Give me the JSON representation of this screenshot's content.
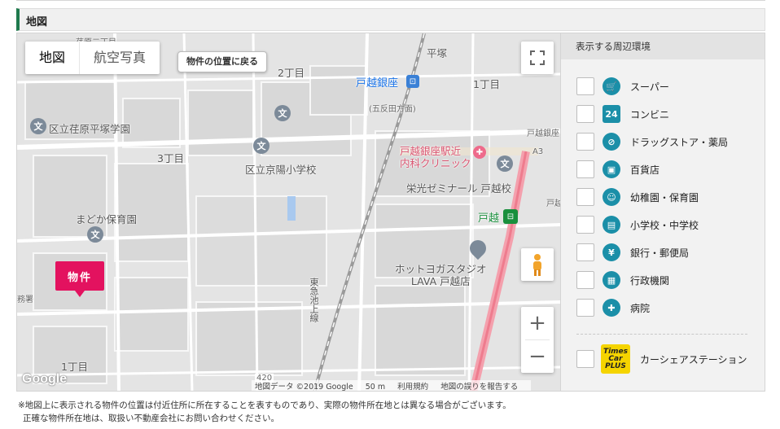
{
  "section": {
    "title": "地図"
  },
  "map": {
    "type_controls": {
      "map": "地図",
      "satellite": "航空写真"
    },
    "return_button": "物件の位置に戻る",
    "property_pin": "物件",
    "labels": {
      "town_name": "荏原二丁目",
      "hiratsuka": "平塚",
      "chome2": "2丁目",
      "chome1_top": "1丁目",
      "chome3": "3丁目",
      "chome1_bottom": "1丁目",
      "station": "戸越銀座",
      "gotanda_dir": "(五反田方面)",
      "station_small": "戸越銀座",
      "school1": "区立荏原平塚学園",
      "school2": "区立京陽小学校",
      "nursery": "まどか保育園",
      "clinic": "戸越銀座駅近\n内科クリニック",
      "seminar": "栄光ゼミナール 戸越校",
      "togoshi_station": "戸越",
      "togoshi_small": "戸越",
      "yoga": "ホットヨガスタジオ\nLAVA 戸越店",
      "railway": "東急池上線",
      "ward": "務署",
      "a3": "A3",
      "route": "420"
    },
    "attribution": {
      "data": "地図データ ©2019 Google",
      "scale": "50 m",
      "terms": "利用規約",
      "report": "地図の誤りを報告する"
    },
    "logo": "Google"
  },
  "panel": {
    "heading": "表示する周辺環境",
    "options": [
      {
        "label": "スーパー",
        "icon": "cart-icon",
        "glyph": "🛒"
      },
      {
        "label": "コンビニ",
        "icon": "convenience-store-icon",
        "glyph": "24"
      },
      {
        "label": "ドラッグストア・薬局",
        "icon": "pill-icon",
        "glyph": "⊘"
      },
      {
        "label": "百貨店",
        "icon": "shopping-bag-icon",
        "glyph": "▣"
      },
      {
        "label": "幼稚園・保育園",
        "icon": "nursery-icon",
        "glyph": "☺"
      },
      {
        "label": "小学校・中学校",
        "icon": "school-bag-icon",
        "glyph": "▤"
      },
      {
        "label": "銀行・郵便局",
        "icon": "bank-icon",
        "glyph": "¥"
      },
      {
        "label": "行政機関",
        "icon": "clipboard-icon",
        "glyph": "▦"
      },
      {
        "label": "病院",
        "icon": "hospital-icon",
        "glyph": "✚"
      }
    ],
    "carshare": {
      "label": "カーシェアステーション",
      "logo_text": "Times\nCar\nPLUS"
    }
  },
  "notes": [
    "※地図上に表示される物件の位置は付近住所に所在することを表すものであり、実際の物件所在地とは異なる場合がございます。",
    "正確な物件所在地は、取扱い不動産会社にお問い合わせください。"
  ]
}
